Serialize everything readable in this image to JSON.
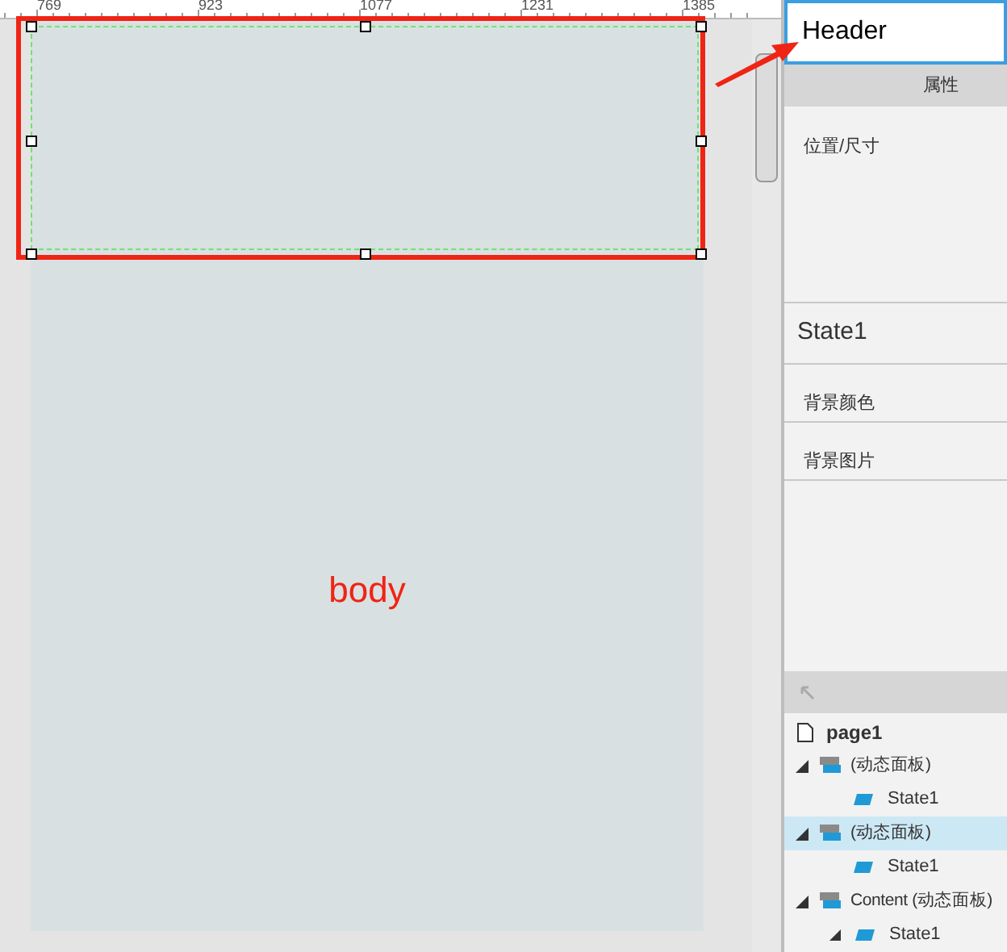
{
  "ruler": {
    "labels": [
      "769",
      "923",
      "1077",
      "1231",
      "1385"
    ]
  },
  "canvas": {
    "header_selected": true,
    "body_label": "body"
  },
  "name_field": {
    "value": "Header"
  },
  "inspector": {
    "tab": "属性",
    "sections": [
      {
        "kind": "label",
        "text": "位置/尺寸"
      },
      {
        "kind": "state",
        "text": "State1"
      },
      {
        "kind": "label",
        "text": "背景颜色"
      },
      {
        "kind": "label",
        "text": "背景图片"
      }
    ]
  },
  "outline": {
    "root": {
      "label": "page1",
      "children": [
        {
          "label": "(动态面板)",
          "expanded": true,
          "selected": false,
          "children": [
            {
              "label": "State1"
            }
          ]
        },
        {
          "label": "(动态面板)",
          "expanded": true,
          "selected": true,
          "children": [
            {
              "label": "State1"
            }
          ]
        },
        {
          "label": "Content (动态面板)",
          "expanded": true,
          "selected": false,
          "children": [
            {
              "label": "State1"
            }
          ]
        }
      ]
    }
  }
}
